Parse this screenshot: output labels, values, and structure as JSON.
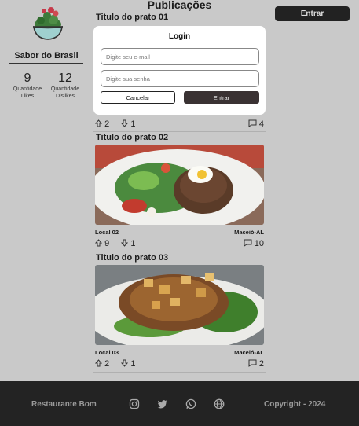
{
  "profile": {
    "name": "Sabor do Brasil",
    "likes_count": "9",
    "likes_label": "Quantidade Likes",
    "dislikes_count": "12",
    "dislikes_label": "Quantidade Dislikes"
  },
  "feed": {
    "title": "Publicações",
    "posts": [
      {
        "title": "Titulo do prato 01",
        "location": "",
        "city": "",
        "likes": "2",
        "dislikes": "1",
        "comments": "4"
      },
      {
        "title": "Titulo do prato 02",
        "location": "Local 02",
        "city": "Maceió-AL",
        "likes": "9",
        "dislikes": "1",
        "comments": "10"
      },
      {
        "title": "Titulo do prato 03",
        "location": "Local 03",
        "city": "Maceió-AL",
        "likes": "2",
        "dislikes": "1",
        "comments": "2"
      }
    ]
  },
  "header": {
    "login_button": "Entrar"
  },
  "modal": {
    "title": "Login",
    "email_placeholder": "Digite seu e-mail",
    "password_placeholder": "Digite sua senha",
    "cancel_label": "Cancelar",
    "submit_label": "Entrar"
  },
  "footer": {
    "name": "Restaurante Bom",
    "copyright": "Copyright - 2024",
    "social_icons": [
      "instagram-icon",
      "twitter-icon",
      "whatsapp-icon",
      "globe-icon"
    ]
  },
  "colors": {
    "background": "#c9c9c9",
    "footer": "#232323",
    "accent_dark": "#3a3233"
  }
}
